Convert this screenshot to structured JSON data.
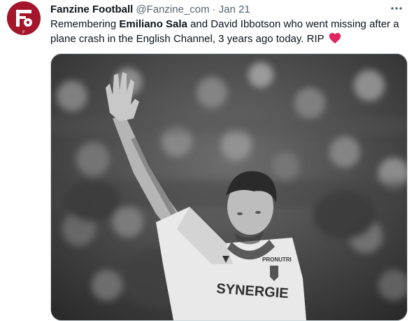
{
  "tweet": {
    "author_name": "Fanzine Football",
    "handle": "@Fanzine_com",
    "separator": "·",
    "date": "Jan 21",
    "text_before": "Remembering ",
    "text_bold": "Emiliano Sala",
    "text_after": " and David Ibbotson who went missing after a plane crash in the English Channel, 3 years ago today. RIP",
    "emoji": "red-heart",
    "avatar_letter": "F"
  },
  "photo": {
    "shirt_sponsor": "SYNERGIE",
    "shirt_brand": "PRONUTRI",
    "colors": "grayscale"
  },
  "colors": {
    "avatar_bg": "#a5162a",
    "heart": "#e0245e",
    "secondary_text": "#536471"
  }
}
